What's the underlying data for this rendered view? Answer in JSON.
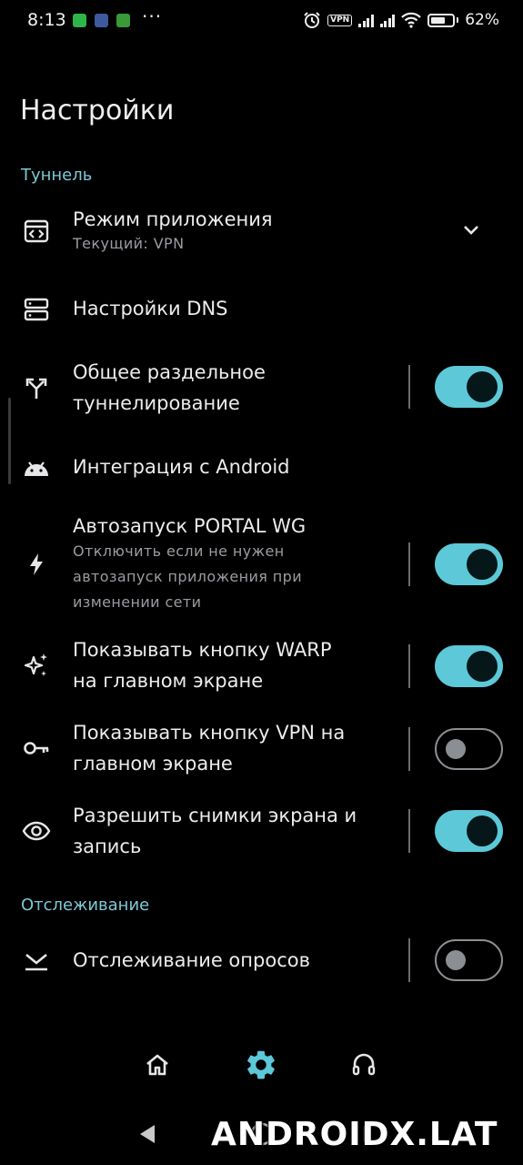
{
  "status_bar": {
    "time": "8:13",
    "dots": "···",
    "vpn_badge": "VPN",
    "battery_pct": "62%"
  },
  "page": {
    "title": "Настройки"
  },
  "sections": {
    "tunnel": "Туннель",
    "tracking": "Отслеживание"
  },
  "settings": {
    "app_mode": {
      "title": "Режим приложения",
      "subtitle": "Текущий: VPN",
      "icon": "code-window-icon"
    },
    "dns": {
      "title": "Настройки DNS",
      "icon": "server-icon"
    },
    "split_tunnel": {
      "line1": "Общее раздельное",
      "line2": "туннелирование",
      "enabled": true,
      "icon": "split-arrows-icon"
    },
    "android_integration": {
      "title": "Интеграция с Android",
      "icon": "android-icon"
    },
    "autostart": {
      "title": "Автозапуск PORTAL WG",
      "sub1": "Отключить если не нужен",
      "sub2": "автозапуск приложения при",
      "sub3": "изменении сети",
      "enabled": true,
      "icon": "bolt-icon"
    },
    "warp_button": {
      "line1": "Показывать кнопку WARP",
      "line2": "на главном экране",
      "enabled": true,
      "icon": "sparkles-icon"
    },
    "vpn_button": {
      "line1": "Показывать кнопку VPN на",
      "line2": "главном экране",
      "enabled": false,
      "icon": "key-icon"
    },
    "screenshots": {
      "line1": "Разрешить снимки экрана и",
      "line2": "запись",
      "enabled": true,
      "icon": "eye-icon"
    },
    "poll_tracking": {
      "title": "Отслеживание опросов",
      "enabled": false,
      "icon": "ping-icon"
    }
  },
  "bottom_nav": [
    "home-icon",
    "gear-icon",
    "headset-icon"
  ],
  "watermark": "ANDROIDX.LAT",
  "colors": {
    "accent": "#5cc8d8",
    "section": "#7ec8d6",
    "background": "#000000"
  }
}
